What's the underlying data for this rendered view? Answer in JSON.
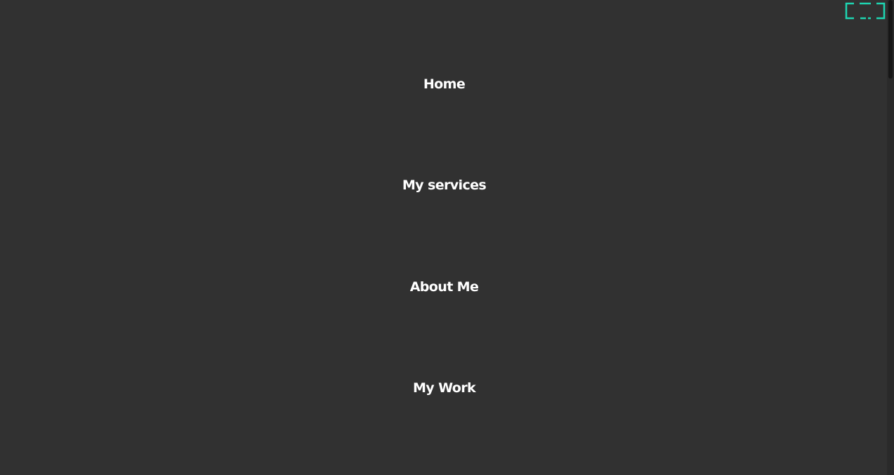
{
  "menu": {
    "items": [
      {
        "label": "Home"
      },
      {
        "label": "My services"
      },
      {
        "label": "About Me"
      },
      {
        "label": "My Work"
      }
    ],
    "toggle_icon": "close-menu-icon",
    "accent_color": "#1ed5b1",
    "text_color": "#ffffff",
    "background_color": "#313131"
  }
}
